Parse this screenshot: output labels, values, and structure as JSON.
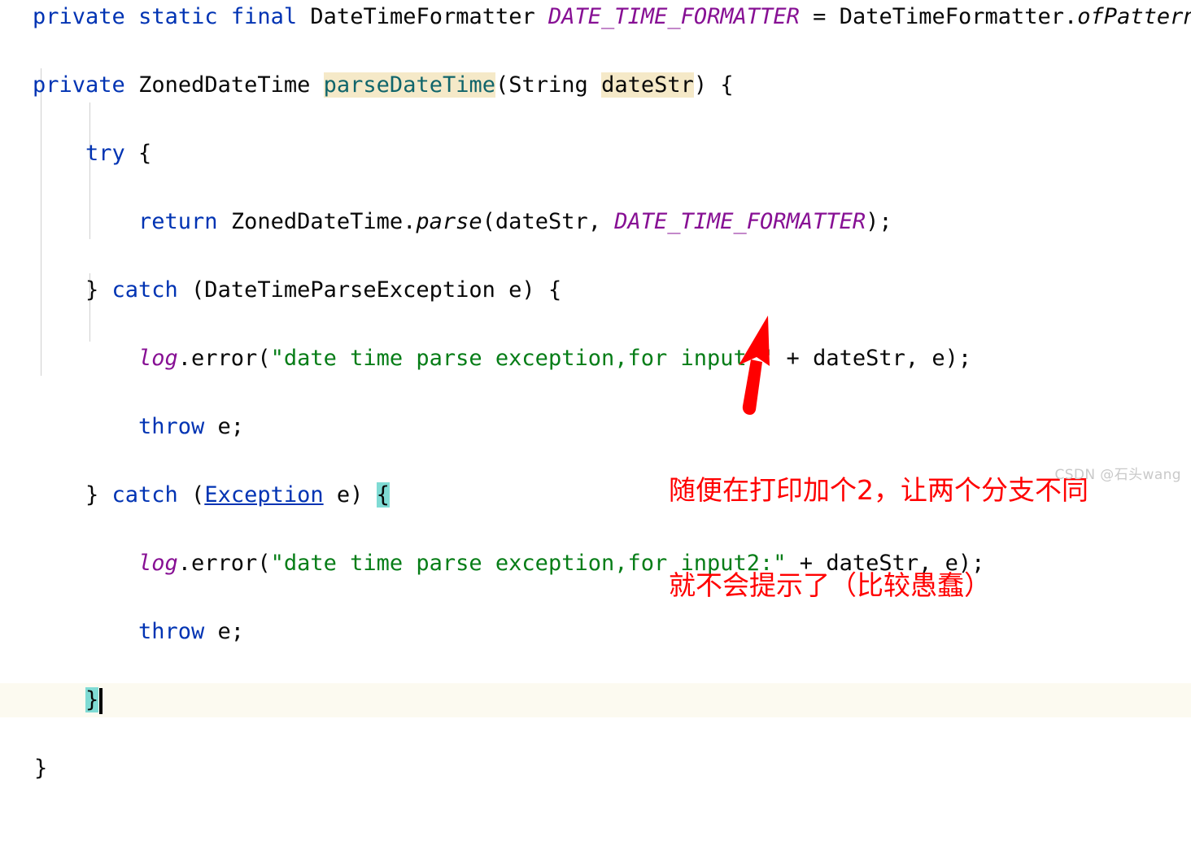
{
  "editor": {
    "language": "java",
    "background": "#FFFFFF",
    "current_line_background": "#FCFAF0",
    "caret_color": "#000000",
    "colors": {
      "keyword": "#0033B3",
      "string": "#067D17",
      "static_field": "#871094",
      "method_declaration": "#10656B",
      "identifier_highlight_bg": "#F5E9C8",
      "brace_match_bg": "#7FDBD4",
      "default_text": "#080808",
      "indent_guide": "#D0D0D0"
    },
    "lines": [
      {
        "n": 1,
        "indent": 0,
        "text": "private static final DateTimeFormatter DATE_TIME_FORMATTER = DateTimeFormatter.ofPattern(",
        "truncated_right": true
      },
      {
        "n": 2,
        "indent": 0,
        "text": "private ZonedDateTime parseDateTime(String dateStr) {"
      },
      {
        "n": 3,
        "indent": 1,
        "text": "try {"
      },
      {
        "n": 4,
        "indent": 2,
        "text": "return ZonedDateTime.parse(dateStr, DATE_TIME_FORMATTER);"
      },
      {
        "n": 5,
        "indent": 1,
        "text": "} catch (DateTimeParseException e) {"
      },
      {
        "n": 6,
        "indent": 2,
        "text": "log.error(\"date time parse exception,for input:\" + dateStr, e);"
      },
      {
        "n": 7,
        "indent": 2,
        "text": "throw e;"
      },
      {
        "n": 8,
        "indent": 1,
        "text": "} catch (Exception e) {"
      },
      {
        "n": 9,
        "indent": 2,
        "text": "log.error(\"date time parse exception,for input2:\" + dateStr, e);"
      },
      {
        "n": 10,
        "indent": 2,
        "text": "throw e;"
      },
      {
        "n": 11,
        "indent": 1,
        "text": "}",
        "is_current_line": true,
        "has_caret": true
      },
      {
        "n": 12,
        "indent": 0,
        "text": "}"
      }
    ],
    "tokens": {
      "l1": {
        "kw_private": "private",
        "kw_static": "static",
        "kw_final": "final",
        "type_formatter": "DateTimeFormatter",
        "const_name": "DATE_TIME_FORMATTER",
        "eq": "=",
        "class_ref": "DateTimeFormatter.",
        "method": "ofPattern",
        "paren": "("
      },
      "l2": {
        "kw_private": "private",
        "type_return": "ZonedDateTime",
        "method_name": "parseDateTime",
        "open_paren": "(",
        "param_type": "String",
        "param_name": "dateStr",
        "close": ") {"
      },
      "l3": {
        "kw_try": "try",
        "brace": " {"
      },
      "l4": {
        "kw_return": "return",
        "class_ref": "ZonedDateTime.",
        "method": "parse",
        "args": "(dateStr, ",
        "const_name": "DATE_TIME_FORMATTER",
        "tail": ");"
      },
      "l5": {
        "close_brace": "} ",
        "kw_catch": "catch",
        "rest": " (DateTimeParseException e) {"
      },
      "l6": {
        "field": "log",
        "call": ".error(",
        "string": "\"date time parse exception,for input:\"",
        "tail": " + dateStr, e);"
      },
      "l7": {
        "kw_throw": "throw",
        "rest": " e;"
      },
      "l8": {
        "close_brace": "} ",
        "kw_catch": "catch",
        "open": " (",
        "exception_link": "Exception",
        "mid": " e) ",
        "brace_highlight": "{"
      },
      "l9": {
        "field": "log",
        "call": ".error(",
        "string": "\"date time parse exception,for input2:\"",
        "tail": " + dateStr, e);"
      },
      "l10": {
        "kw_throw": "throw",
        "rest": " e;"
      },
      "l11": {
        "brace_highlight": "}"
      },
      "l12": {
        "brace": "}"
      }
    }
  },
  "annotation": {
    "color": "#FF0000",
    "line1": "随便在打印加个2，让两个分支不同",
    "line2": "就不会提示了（比较愚蠢）",
    "arrow": {
      "name": "up-arrow",
      "color": "#FF0000",
      "points_to": "line 9 log.error input2 string"
    }
  },
  "watermark": {
    "text": "CSDN @石头wang",
    "color": "#C9C9C9"
  }
}
